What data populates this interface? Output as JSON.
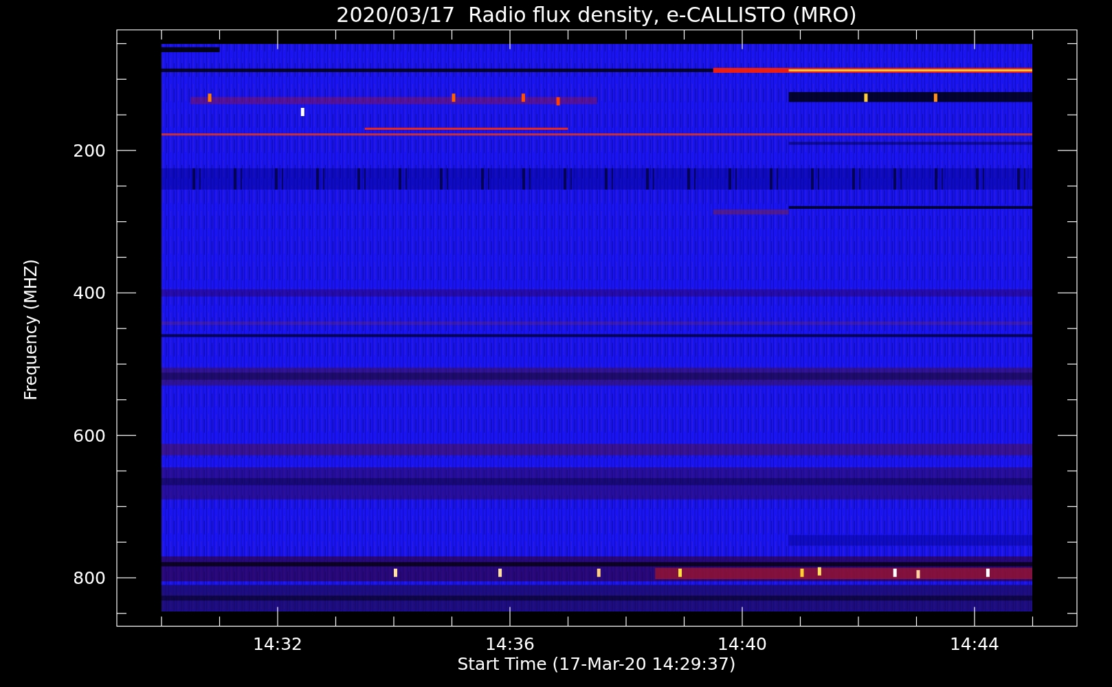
{
  "title": "2020/03/17  Radio flux density, e-CALLISTO (MRO)",
  "y_axis": {
    "label": "Frequency (MHZ)",
    "ticks": [
      "200",
      "400",
      "600",
      "800"
    ]
  },
  "x_axis": {
    "label": "Start Time (17-Mar-20 14:29:37)",
    "ticks": [
      "14:32",
      "14:36",
      "14:40",
      "14:44"
    ]
  }
}
